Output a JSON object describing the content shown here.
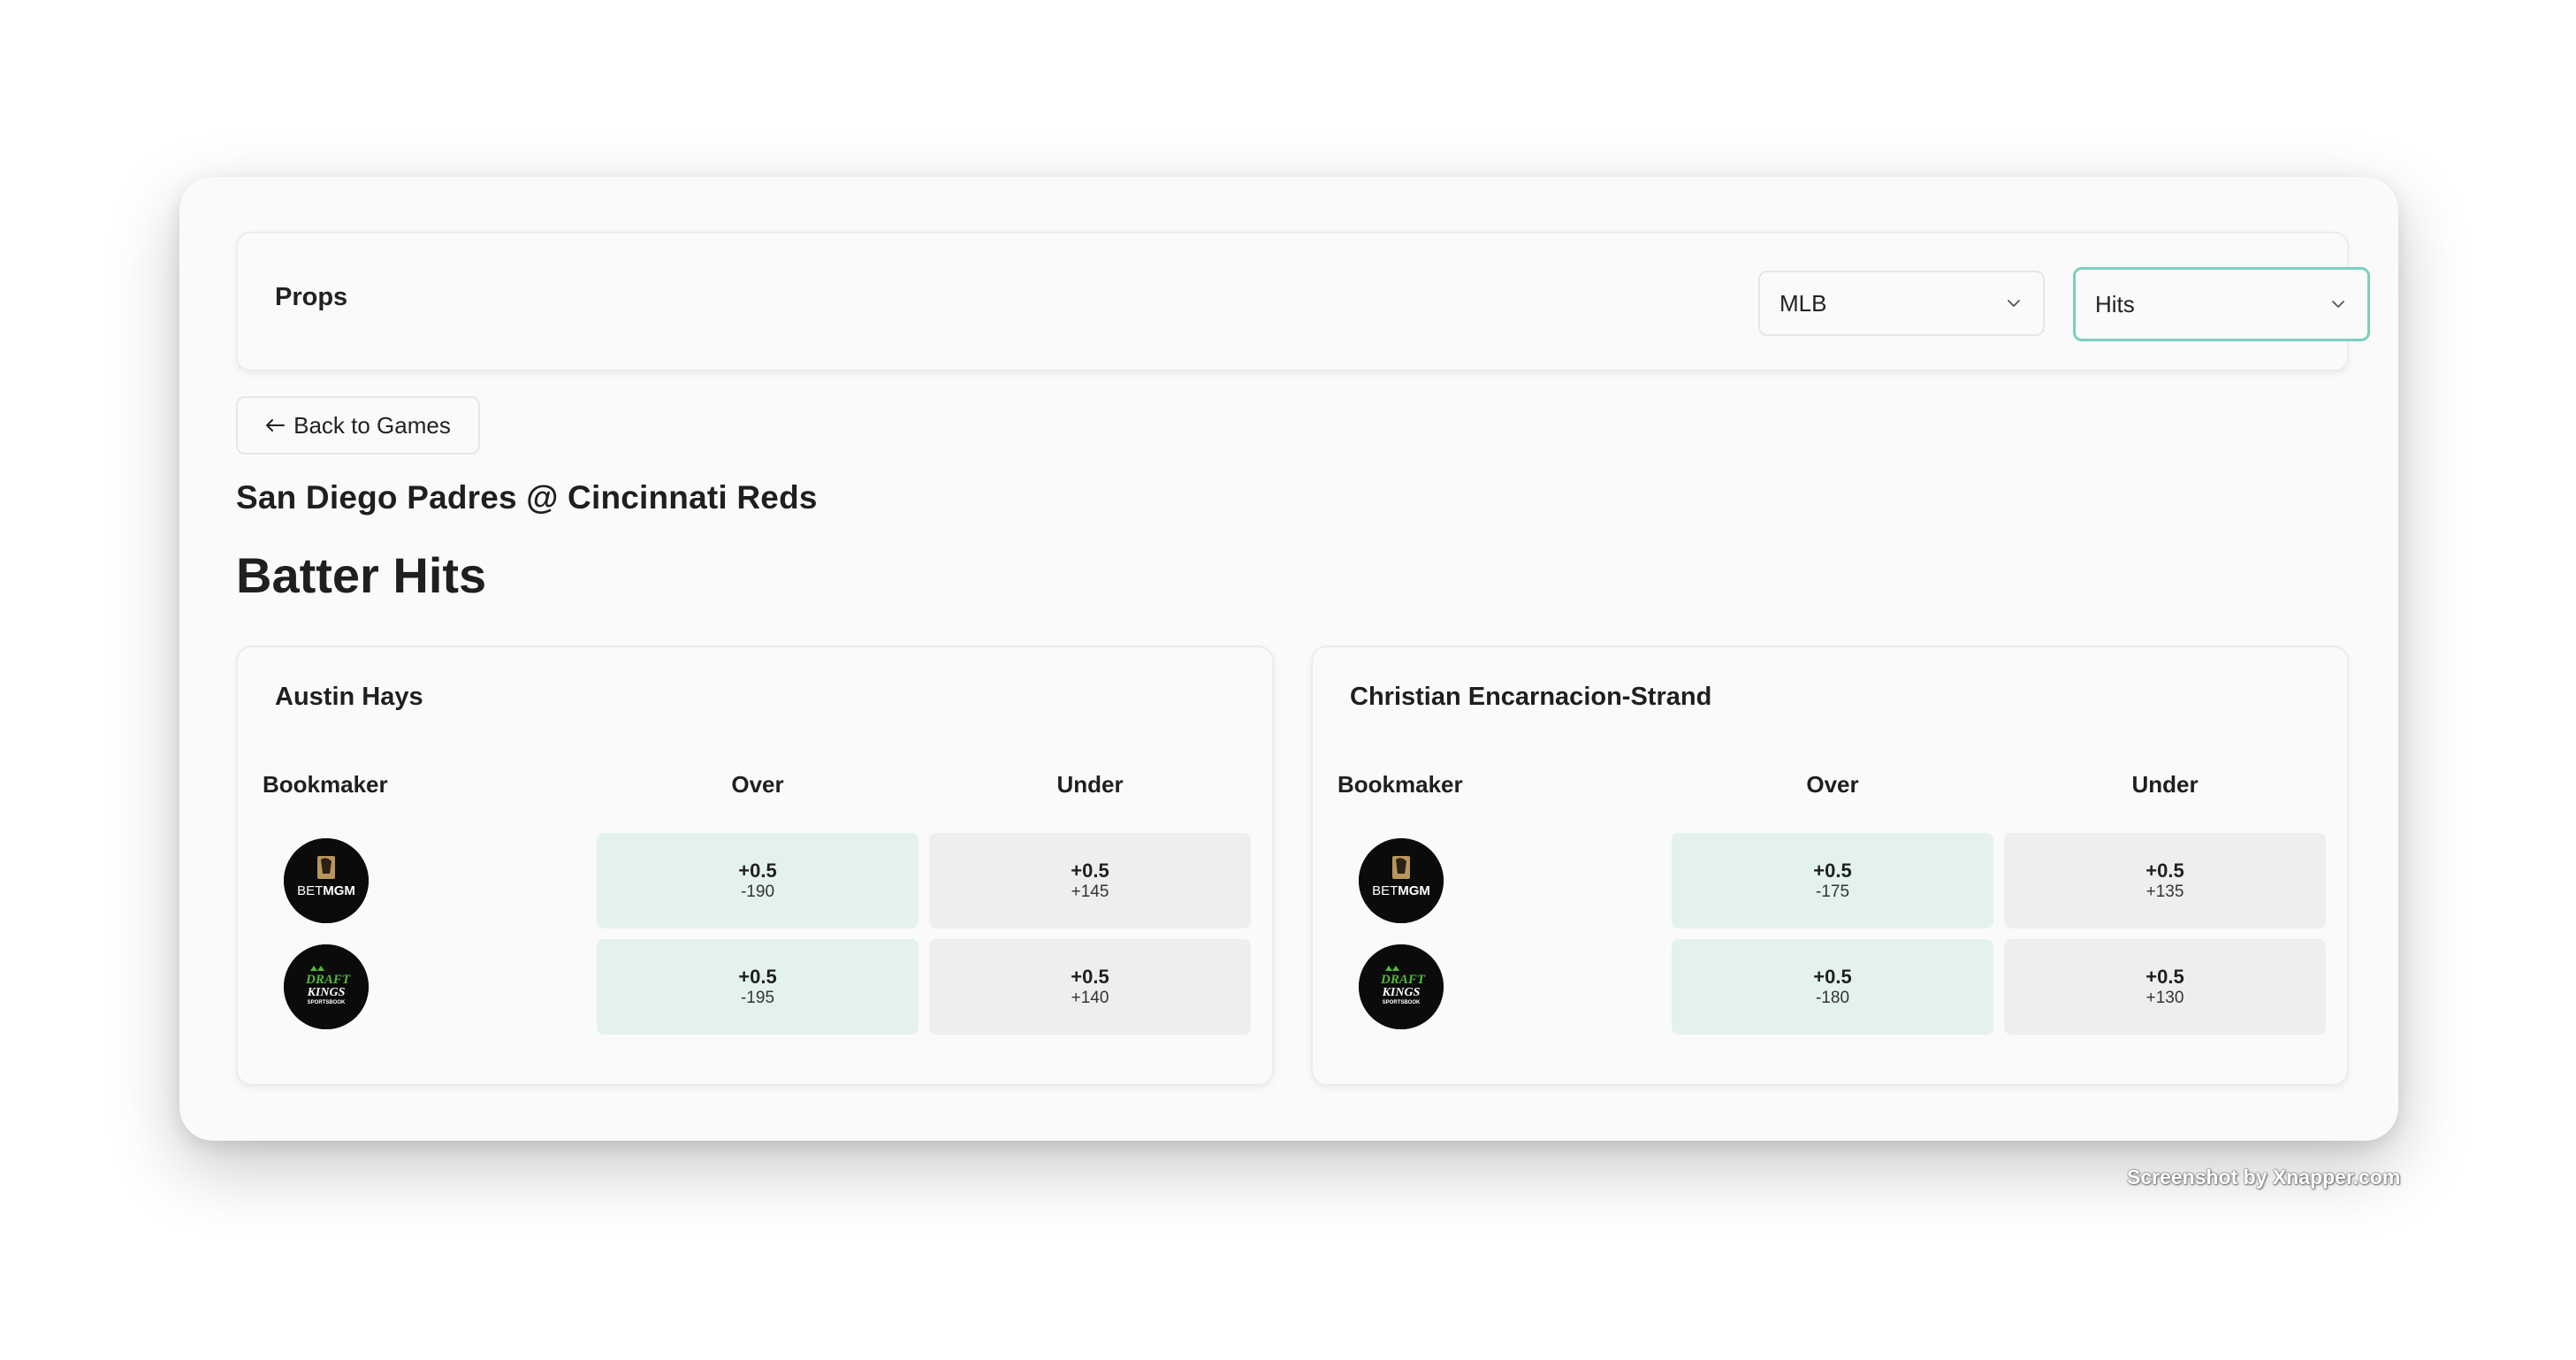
{
  "header": {
    "title": "Props",
    "league_select": {
      "value": "MLB"
    },
    "market_select": {
      "value": "Hits"
    }
  },
  "back_button": {
    "label": "Back to Games",
    "icon": "arrow-left-icon"
  },
  "game": {
    "title": "San Diego Padres @ Cincinnati Reds"
  },
  "market": {
    "title": "Batter Hits"
  },
  "table_headers": {
    "bookmaker": "Bookmaker",
    "over": "Over",
    "under": "Under"
  },
  "players": [
    {
      "name": "Austin Hays",
      "rows": [
        {
          "bookmaker": "BetMGM",
          "over_point": "+0.5",
          "over_price": "-190",
          "under_point": "+0.5",
          "under_price": "+145"
        },
        {
          "bookmaker": "DraftKings",
          "over_point": "+0.5",
          "over_price": "-195",
          "under_point": "+0.5",
          "under_price": "+140"
        }
      ]
    },
    {
      "name": "Christian Encarnacion-Strand",
      "rows": [
        {
          "bookmaker": "BetMGM",
          "over_point": "+0.5",
          "over_price": "-175",
          "under_point": "+0.5",
          "under_price": "+135"
        },
        {
          "bookmaker": "DraftKings",
          "over_point": "+0.5",
          "over_price": "-180",
          "under_point": "+0.5",
          "under_price": "+130"
        }
      ]
    }
  ],
  "logos": {
    "betmgm": {
      "text_bet": "BET",
      "text_mgm": "MGM"
    },
    "draftkings": {
      "text_draft": "DRAFT",
      "text_kings": "KINGS",
      "text_sub": "SPORTSBOOK"
    }
  },
  "colors": {
    "accent": "#7ccfc0",
    "over_bg": "#e3f2ee",
    "under_bg": "#eeeeee",
    "dk_green": "#53b83a",
    "mgm_gold": "#b8955b"
  },
  "watermark": "Screenshot by Xnapper.com"
}
